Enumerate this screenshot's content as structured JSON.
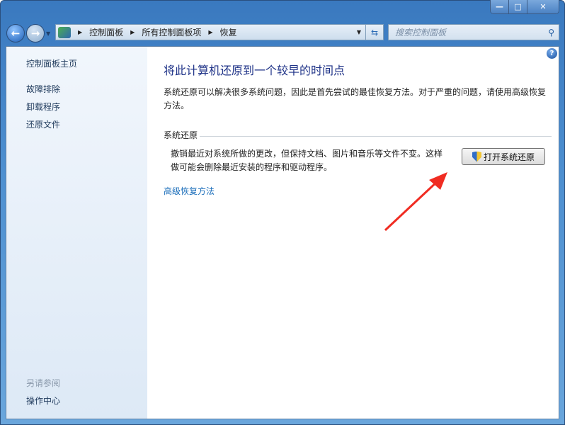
{
  "window": {
    "minimize": "—",
    "maximize": "□",
    "close": "✕"
  },
  "address": {
    "crumbs": [
      "控制面板",
      "所有控制面板项",
      "恢复"
    ]
  },
  "search": {
    "placeholder": "搜索控制面板"
  },
  "sidebar": {
    "home": "控制面板主页",
    "items": [
      "故障排除",
      "卸载程序",
      "还原文件"
    ],
    "see_also": "另请参阅",
    "see_also_items": [
      "操作中心"
    ]
  },
  "main": {
    "title": "将此计算机还原到一个较早的时间点",
    "intro": "系统还原可以解决很多系统问题，因此是首先尝试的最佳恢复方法。对于严重的问题，请使用高级恢复方法。",
    "section": "系统还原",
    "description": "撤销最近对系统所做的更改，但保持文档、图片和音乐等文件不变。这样做可能会删除最近安装的程序和驱动程序。",
    "button": "打开系统还原",
    "advanced_link": "高级恢复方法",
    "help": "?"
  },
  "colors": {
    "accent": "#1a6dba",
    "annotation_arrow": "#f02c22"
  }
}
